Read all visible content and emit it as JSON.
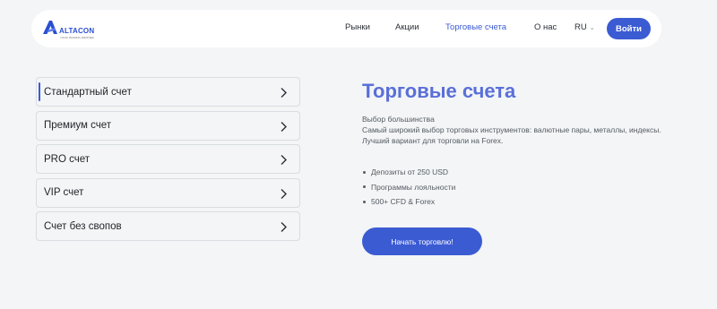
{
  "header": {
    "logo_text": "ALTACON",
    "logo_subtext": "YOUR TRADING PARTNER",
    "nav": [
      {
        "label": "Рынки"
      },
      {
        "label": "Акции"
      },
      {
        "label": "Торговые счета",
        "active": true
      },
      {
        "label": "О нас"
      }
    ],
    "language": "RU",
    "login_label": "Войти"
  },
  "accounts": [
    {
      "label": "Стандартный счет",
      "selected": true
    },
    {
      "label": "Премиум счет"
    },
    {
      "label": "PRO счет"
    },
    {
      "label": "VIP счет"
    },
    {
      "label": "Счет без свопов"
    }
  ],
  "main": {
    "title": "Торговые счета",
    "description": [
      "Выбор большинства",
      "Самый широкий выбор торговых инструментов: валютные пары, металлы, индексы.",
      "Лучший вариант для торговли на Forex."
    ],
    "bullets": [
      "Депозиты от 250 USD",
      "Программы лояльности",
      "500+ CFD & Forex"
    ],
    "cta_label": "Начать торговлю!"
  },
  "colors": {
    "accent": "#3b5bd3",
    "title": "#5a6fd8",
    "background": "#f3f5f6"
  }
}
